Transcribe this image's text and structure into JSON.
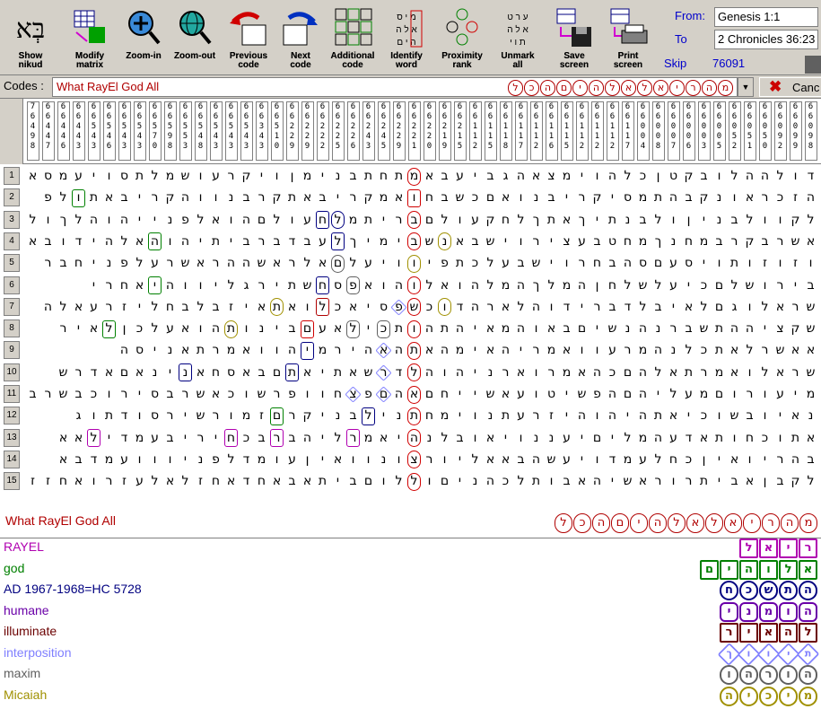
{
  "toolbar": {
    "buttons": [
      {
        "id": "show-nikud",
        "label_lines": [
          "Show",
          "nikud"
        ],
        "icon": "hebrew-bet-aleph-icon"
      },
      {
        "id": "modify-matrix",
        "label_lines": [
          "Modify",
          "matrix"
        ],
        "icon": "matrix-grid-icon"
      },
      {
        "id": "zoom-in",
        "label_lines": [
          "Zoom-in"
        ],
        "icon": "magnifier-plus-icon"
      },
      {
        "id": "zoom-out",
        "label_lines": [
          "Zoom-out"
        ],
        "icon": "magnifier-globe-icon"
      },
      {
        "id": "previous-code",
        "label_lines": [
          "Previous",
          "code"
        ],
        "icon": "arrow-left-grid-icon"
      },
      {
        "id": "next-code",
        "label_lines": [
          "Next",
          "code"
        ],
        "icon": "arrow-right-grid-icon"
      },
      {
        "id": "additional-code",
        "label_lines": [
          "Additional",
          "code"
        ],
        "icon": "multi-grid-icon"
      },
      {
        "id": "identify-word",
        "label_lines": [
          "Identify",
          "word"
        ],
        "icon": "letters-grid-icon"
      },
      {
        "id": "proximity-rank",
        "label_lines": [
          "Proximity",
          "rank"
        ],
        "icon": "proximity-icon"
      },
      {
        "id": "unmark-all",
        "label_lines": [
          "Unmark",
          "all"
        ],
        "icon": "unmark-grid-icon"
      },
      {
        "id": "save-screen",
        "label_lines": [
          "Save",
          "screen"
        ],
        "icon": "floppy-disk-icon"
      },
      {
        "id": "print-screen",
        "label_lines": [
          "Print",
          "screen"
        ],
        "icon": "printer-icon"
      }
    ],
    "range": {
      "from_label": "From:",
      "from_value": "Genesis 1:1",
      "to_label": "To",
      "to_value": "2 Chronicles 36:23"
    },
    "skip_label": "Skip",
    "skip_value": "76091"
  },
  "codes": {
    "label": "Codes :",
    "text": "What RayEl God All",
    "hebrew": [
      "מ",
      "ה",
      "ר",
      "י",
      "א",
      "ל",
      "א",
      "ל",
      "ה",
      "י",
      "ם",
      "ה",
      "כ",
      "ל"
    ],
    "cancel_label": "Canc"
  },
  "skip_columns": [
    "76498",
    "66447",
    "66446",
    "66443",
    "66543",
    "66546",
    "66543",
    "66543",
    "66570",
    "66598",
    "66553",
    "66548",
    "66543",
    "66543",
    "66543",
    "66343",
    "66510",
    "66229",
    "66229",
    "66222",
    "66225",
    "66226",
    "66243",
    "66245",
    "66229",
    "66221",
    "66220",
    "66219",
    "66215",
    "66112",
    "66115",
    "66118",
    "66117",
    "66112",
    "66116",
    "66115",
    "66112",
    "66112",
    "66112",
    "66117",
    "66004",
    "66008",
    "66007",
    "66006",
    "66003",
    "66005",
    "66052",
    "66051",
    "66050",
    "66092",
    "66099",
    "66098"
  ],
  "matrix_rows": [
    {
      "num": "1",
      "text": "דולההלובקטןכלהוימצאהגביעבאמתחתבנימןויקרעושמלתסויעמסא"
    },
    {
      "num": "2",
      "text": "הזכראונקבהתמסיקריבנואםכשבחואמקריבאתקרבנווהקריבאתולפ"
    },
    {
      "num": "3",
      "text": "לקוולבניןולבנתיךאתךלחקעולםבריתמלחעולםהואלפנייהוהלךולזו"
    },
    {
      "num": "4",
      "text": "אשרבקרבמחנךמחטבעצירוישבאנשבימיךלעבדברביתיהוהאלהידובא"
    },
    {
      "num": "5",
      "text": "וזוזותויסעםסהבחרוישבעלכתפיוויעלםאלראשההראשרעלפניחבר"
    },
    {
      "num": "6",
      "text": "בירושלםכיעלשלחןהמלךהמלהואלוהואפסחשתירגליווהיאחרי"
    },
    {
      "num": "7",
      "text": "שראלוגםלאיבלדברידוהלארהדוכשפסיאכלואתאיזבלבחליזרעאלה"
    },
    {
      "num": "8",
      "text": "שקציההתשברנהנשיםבאוהמאיהתהותכילאעםבינותהואעלכןלאיר"
    },
    {
      "num": "9",
      "text": "אאשרלאתכלנהמרעוואמריהאימהאתהאהירמיהוואמרתאניסה"
    },
    {
      "num": "10",
      "text": "שראלואמרתאלהםכהאמרוארניהוהלדרשאתיאתםבאסחאנינאםאדרש"
    },
    {
      "num": "11",
      "text": "מיעורוםמעליהםהפשיטועאשייחםאהםפצחוופרשוכאשרבסירוכבשרב"
    },
    {
      "num": "12",
      "text": "נאיובשוכיאתהיהוהיזרעתנוימחתנילבניקרםזמורשירסודתוג"
    },
    {
      "num": "13",
      "text": "אתוכחותאדעהמליםיעננויאובלנהיאמרליהברבכחיריבעמדילאא"
    },
    {
      "num": "14",
      "text": "בהריואיןכחלעמדויעשהבאאליורצונוואיןעומדלפניווועמדבא"
    },
    {
      "num": "15",
      "text": "לקבןאביתרוראשיהאבותלכהניםוללוםביתאבאחדאחזלאלעזרואחזז"
    }
  ],
  "code_title": {
    "text": "What RayEl God All",
    "hebrew": [
      "מ",
      "ה",
      "ר",
      "י",
      "א",
      "ל",
      "א",
      "ל",
      "ה",
      "י",
      "ם",
      "ה",
      "כ",
      "ל"
    ]
  },
  "terms": [
    {
      "label": "RAYEL",
      "color": "#b000b0",
      "shape": "rect",
      "hebrew": [
        "ר",
        "י",
        "א",
        "ל"
      ]
    },
    {
      "label": "god",
      "color": "#008000",
      "shape": "rect",
      "hebrew": [
        "א",
        "ל",
        "ו",
        "ה",
        "י",
        "ם"
      ]
    },
    {
      "label": "AD 1967-1968=HC 5728",
      "color": "#000080",
      "shape": "circle",
      "hebrew": [
        "ה",
        "ת",
        "ש",
        "כ",
        "ח"
      ]
    },
    {
      "label": "humane",
      "color": "#6a00a8",
      "shape": "hex",
      "hebrew": [
        "ה",
        "ו",
        "מ",
        "נ",
        "י"
      ]
    },
    {
      "label": "illuminate",
      "color": "#6b0000",
      "shape": "rect",
      "hebrew": [
        "ל",
        "ה",
        "א",
        "י",
        "ר"
      ]
    },
    {
      "label": "interposition",
      "color": "#8080ff",
      "shape": "diamond",
      "hebrew": [
        "ת",
        "י",
        "ו",
        "ו",
        "ך"
      ]
    },
    {
      "label": "maxim",
      "color": "#606060",
      "shape": "circle",
      "hebrew": [
        "ה",
        "ו",
        "ר",
        "ה",
        "ו"
      ]
    },
    {
      "label": "Micaiah",
      "color": "#a09000",
      "shape": "circle",
      "hebrew": [
        "מ",
        "י",
        "כ",
        "י",
        "ה"
      ]
    }
  ]
}
